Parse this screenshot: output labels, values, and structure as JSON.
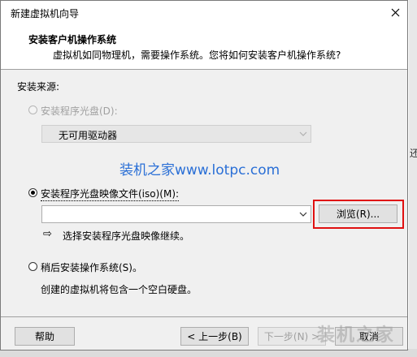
{
  "window": {
    "title": "新建虚拟机向导"
  },
  "header": {
    "title": "安装客户机操作系统",
    "description": "虚拟机如同物理机，需要操作系统。您将如何安装客户机操作系统?"
  },
  "source_label": "安装来源:",
  "options": {
    "disc": {
      "label": "安装程序光盘(D):",
      "selected": false,
      "enabled": false,
      "dropdown_value": "无可用驱动器"
    },
    "iso": {
      "label": "安装程序光盘映像文件(iso)(M):",
      "selected": true,
      "path_value": "",
      "browse_label": "浏览(R)...",
      "hint": "选择安装程序光盘映像继续。"
    },
    "later": {
      "label": "稍后安装操作系统(S)。",
      "selected": false,
      "description": "创建的虚拟机将包含一个空白硬盘。"
    }
  },
  "watermark": "装机之家www.lotpc.com",
  "footer": {
    "help": "帮助",
    "back": "< 上一步(B)",
    "next": "下一步(N) >",
    "cancel": "取消",
    "watermark_text": "装机之家"
  },
  "background_text": "还",
  "colors": {
    "highlight": "#e01010",
    "watermark": "#2a6fd6"
  }
}
